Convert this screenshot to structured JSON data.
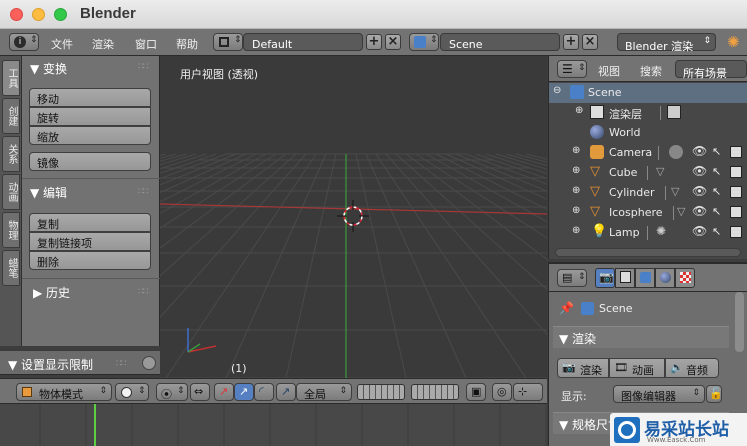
{
  "window": {
    "title": "Blender"
  },
  "topbar": {
    "menus": [
      "文件",
      "渲染",
      "窗口",
      "帮助"
    ],
    "screen_layout": "Default",
    "scene": "Scene",
    "render_engine": "Blender 渲染"
  },
  "tool_tabs": [
    "工具",
    "创建",
    "关系",
    "动画",
    "物理",
    "蜡笔"
  ],
  "tool_shelf": {
    "transform_header": "▼ 变换",
    "transform_buttons": [
      "移动",
      "旋转",
      "缩放"
    ],
    "mirror_button": "镜像",
    "edit_header": "▼ 编辑",
    "edit_buttons": [
      "复制",
      "复制链接项",
      "删除"
    ],
    "history_header": "▶ 历史",
    "display_limits": "▼ 设置显示限制"
  },
  "viewport": {
    "title": "用户视图 (透视)",
    "frame_label": "(1)"
  },
  "viewport_header": {
    "mode": "物体模式",
    "pivot": "全局"
  },
  "outliner_header": {
    "view": "视图",
    "search": "搜索",
    "filter": "所有场景"
  },
  "outliner": [
    {
      "label": "Scene",
      "icon": "scene-icon"
    },
    {
      "label": "渲染层",
      "icon": "render-layers-icon"
    },
    {
      "label": "World",
      "icon": "world-icon"
    },
    {
      "label": "Camera",
      "icon": "camera-icon"
    },
    {
      "label": "Cube",
      "icon": "mesh-icon"
    },
    {
      "label": "Cylinder",
      "icon": "mesh-icon"
    },
    {
      "label": "Icosphere",
      "icon": "mesh-icon"
    },
    {
      "label": "Lamp",
      "icon": "lamp-icon"
    }
  ],
  "properties": {
    "scene_label": "Scene",
    "render_header": "▼ 渲染",
    "render_buttons": [
      "渲染",
      "动画",
      "音频"
    ],
    "display_label": "显示:",
    "display_value": "图像编辑器",
    "dimensions_header": "▼ 规格尺寸"
  },
  "watermark": {
    "brand": "易采站长站",
    "url": "Www.Easck.Com"
  },
  "colors": {
    "grid_line": "#4a4a4a",
    "x_axis": "#b03a3a",
    "y_axis": "#3fa33f",
    "selection_orange": "#f2913a"
  }
}
